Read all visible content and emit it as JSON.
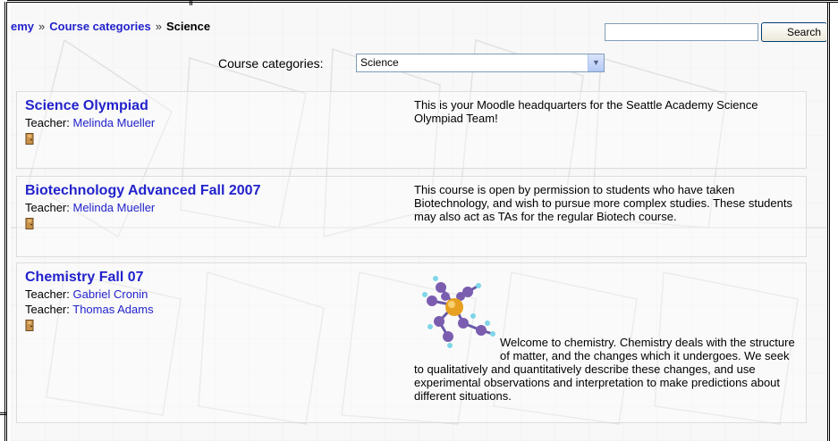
{
  "breadcrumb": {
    "items": [
      {
        "label": "emy"
      },
      {
        "label": "Course categories"
      }
    ],
    "separator": "»",
    "current": "Science"
  },
  "search": {
    "value": "",
    "button_label": "Search"
  },
  "category": {
    "label": "Course categories:",
    "selected": "Science"
  },
  "courses": [
    {
      "title": "Science Olympiad",
      "teachers": [
        {
          "role": "Teacher:",
          "name": "Melinda Mueller"
        }
      ],
      "summary": "This is your Moodle headquarters for the Seattle Academy Science Olympiad Team!"
    },
    {
      "title": "Biotechnology Advanced Fall 2007",
      "teachers": [
        {
          "role": "Teacher:",
          "name": "Melinda Mueller"
        }
      ],
      "summary": "This course is open by permission to students who have taken Biotechnology, and wish to pursue more complex studies.  These students may also act as TAs for the regular Biotech course."
    },
    {
      "title": "Chemistry Fall 07",
      "teachers": [
        {
          "role": "Teacher:",
          "name": "Gabriel Cronin"
        },
        {
          "role": "Teacher:",
          "name": "Thomas Adams"
        }
      ],
      "summary": "Welcome to chemistry. Chemistry deals with the structure of matter, and the changes which it undergoes. We seek to qualitatively and quantitatively describe these changes, and use experimental observations and interpretation to make predictions about different situations."
    }
  ],
  "icons": {
    "guest_access": "door-icon",
    "dropdown": "chevron-down-icon",
    "molecule": "molecule-image"
  },
  "colors": {
    "link": "#2222cc",
    "border": "#dddddd",
    "background": "#f8f8f8"
  }
}
